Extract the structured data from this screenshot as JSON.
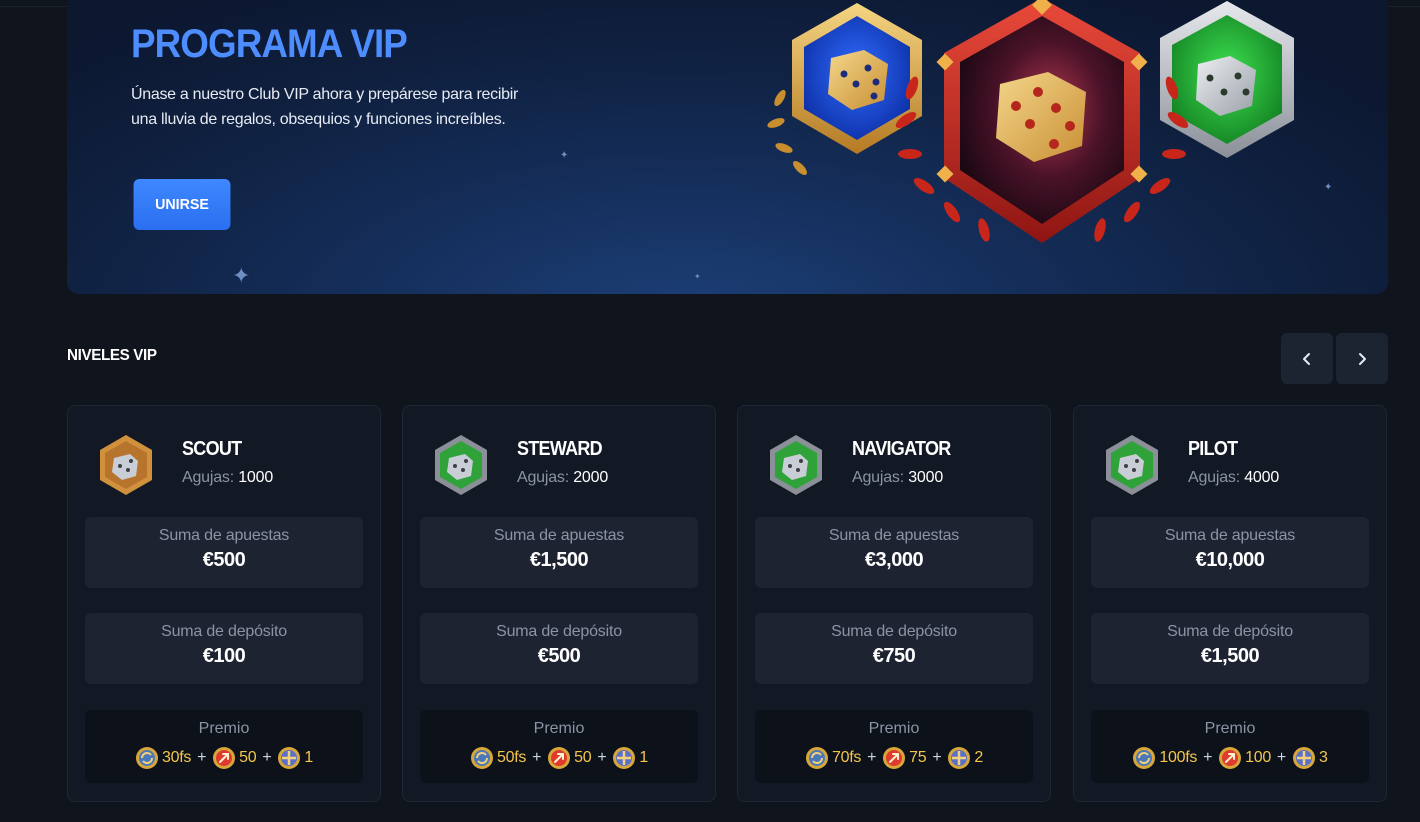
{
  "hero": {
    "title": "PROGRAMA VIP",
    "description": "Únase a nuestro Club VIP ahora y prepárese para recibir una lluvia de regalos, obsequios y funciones increíbles.",
    "join_label": "UNIRSE"
  },
  "levels_section": {
    "title": "NIVELES VIP"
  },
  "labels": {
    "needles": "Agujas:",
    "bets": "Suma de apuestas",
    "deposit": "Suma de depósito",
    "prize": "Premio"
  },
  "cards": [
    {
      "name": "SCOUT",
      "needles": "1000",
      "bets": "€500",
      "deposit": "€100",
      "fs": "30fs",
      "rockets": "50",
      "tokens": "1",
      "badge_color": "#b7742d"
    },
    {
      "name": "STEWARD",
      "needles": "2000",
      "bets": "€1,500",
      "deposit": "€500",
      "fs": "50fs",
      "rockets": "50",
      "tokens": "1",
      "badge_color": "#2fa23a"
    },
    {
      "name": "NAVIGATOR",
      "needles": "3000",
      "bets": "€3,000",
      "deposit": "€750",
      "fs": "70fs",
      "rockets": "75",
      "tokens": "2",
      "badge_color": "#2fa23a"
    },
    {
      "name": "PILOT",
      "needles": "4000",
      "bets": "€10,000",
      "deposit": "€1,500",
      "fs": "100fs",
      "rockets": "100",
      "tokens": "3",
      "badge_color": "#2fa23a"
    }
  ],
  "colors": {
    "accent": "#4d8dff",
    "button": "#2f7bff",
    "prize_text": "#f4c64a"
  }
}
